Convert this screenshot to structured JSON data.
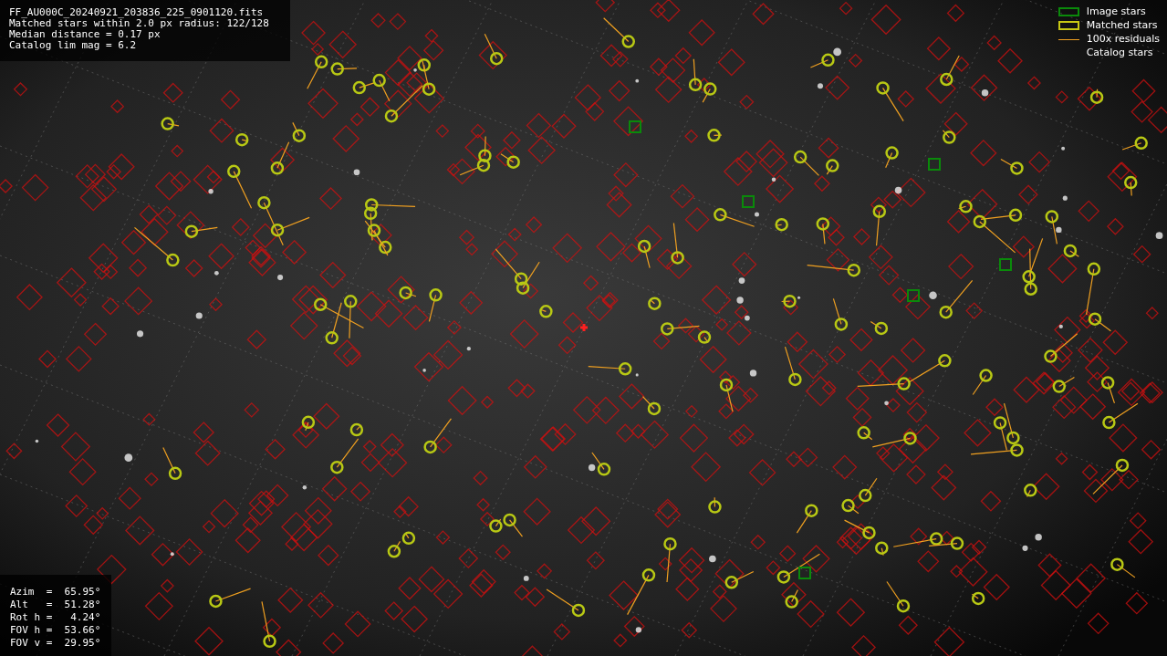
{
  "info_panel": {
    "lines": [
      "FF_AU000C_20240921_203836_225_0901120.fits",
      "Matched stars within 2.0 px radius: 122/128",
      "Median distance = 0.17 px",
      "Catalog lim mag = 6.2"
    ]
  },
  "legend": [
    {
      "kind": "box",
      "color": "#0a8a0a",
      "label": "Image stars"
    },
    {
      "kind": "box",
      "color": "#c8c814",
      "label": "Matched stars"
    },
    {
      "kind": "line",
      "color": "#f0a020",
      "label": "100x residuals"
    },
    {
      "kind": "none",
      "label": "Catalog stars"
    }
  ],
  "pointing_panel": {
    "lines": [
      "Azim  =  65.95°",
      "Alt   =  51.28°",
      "Rot h =   4.24°",
      "FOV h =  53.66°",
      "FOV v =  29.95°"
    ]
  }
}
